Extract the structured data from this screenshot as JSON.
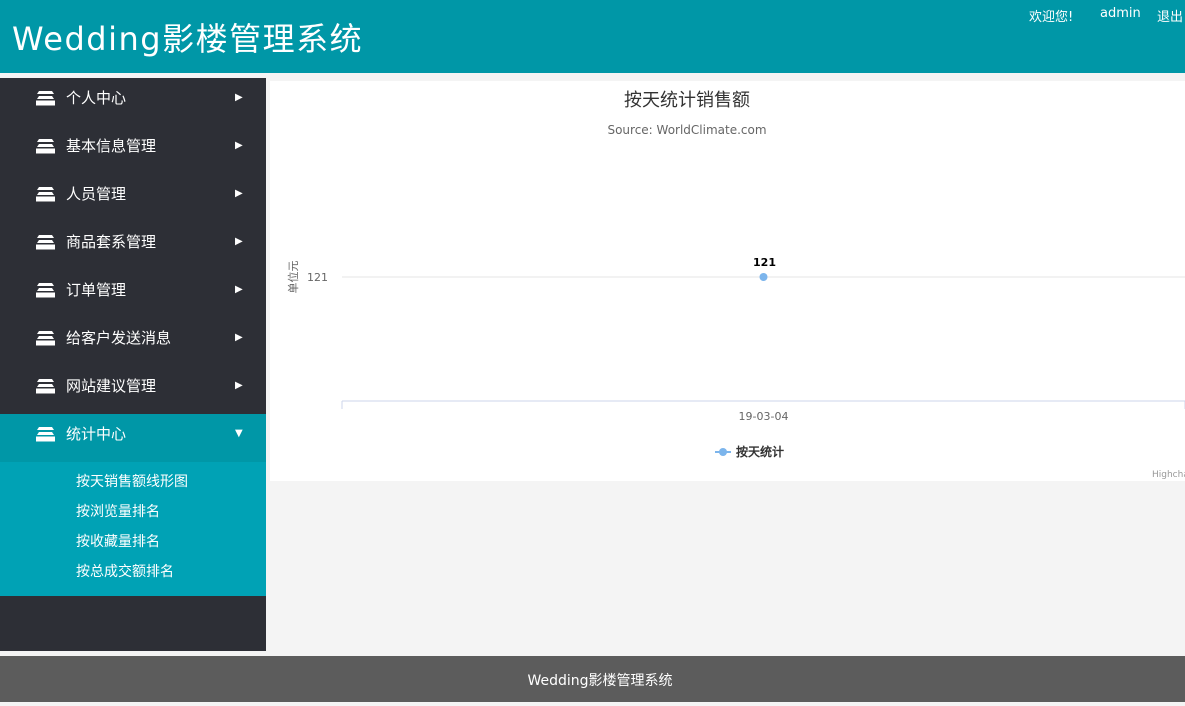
{
  "header": {
    "app_title": "Wedding影楼管理系统",
    "welcome": "欢迎您!",
    "username": "admin",
    "logout": "退出"
  },
  "sidebar": {
    "items": [
      {
        "label": "个人中心",
        "icon": "stack-icon",
        "active": false
      },
      {
        "label": "基本信息管理",
        "icon": "stack-icon",
        "active": false
      },
      {
        "label": "人员管理",
        "icon": "stack-icon",
        "active": false
      },
      {
        "label": "商品套系管理",
        "icon": "stack-icon",
        "active": false
      },
      {
        "label": "订单管理",
        "icon": "stack-icon",
        "active": false
      },
      {
        "label": "给客户发送消息",
        "icon": "stack-icon",
        "active": false
      },
      {
        "label": "网站建议管理",
        "icon": "stack-icon",
        "active": false
      },
      {
        "label": "统计中心",
        "icon": "stack-icon",
        "active": true
      }
    ],
    "submenu": [
      {
        "label": "按天销售额线形图"
      },
      {
        "label": "按浏览量排名"
      },
      {
        "label": "按收藏量排名"
      },
      {
        "label": "按总成交额排名"
      }
    ]
  },
  "chart_data": {
    "type": "line",
    "title": "按天统计销售额",
    "subtitle": "Source: WorldClimate.com",
    "ylabel": "单位元",
    "xlabel": "",
    "categories": [
      "19-03-04"
    ],
    "yticks": [
      121
    ],
    "series": [
      {
        "name": "按天统计",
        "values": [
          121
        ],
        "data_labels": [
          "121"
        ],
        "color": "#7cb5ec"
      }
    ],
    "legend": "bottom-center",
    "grid": true,
    "credits": "Highcharts.com"
  },
  "footer": {
    "text": "Wedding影楼管理系统"
  },
  "colors": {
    "header": "#0097a7",
    "sidebar": "#2d2f36",
    "active_item": "#0097a7",
    "submenu": "#00a2b5",
    "footer": "#5c5c5c",
    "series": "#7cb5ec"
  }
}
